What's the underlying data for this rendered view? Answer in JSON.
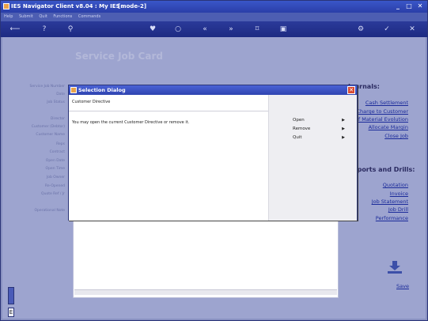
{
  "window": {
    "title": "IES Navigator Client v8.04 : My IES :",
    "mode": "[mode-2]",
    "controls": [
      "_",
      "□",
      "✕"
    ]
  },
  "menubar": [
    "Help",
    "Submit",
    "Quit",
    "Functions",
    "Commands"
  ],
  "page": {
    "title": "Service Job Card",
    "field_labels": [
      "Service Job Number",
      "Date",
      "Job Status",
      "Director",
      "Customer (Debtor)",
      "Customer Name",
      "Reps",
      "Contract",
      "Open Date",
      "Open Time",
      "Job Owner",
      "Re-Opened",
      "Quote Ref / Jr",
      "Operational Note"
    ]
  },
  "right_panel": {
    "journals_title": "Journals:",
    "journal_links": [
      "Cash Settlement",
      "Re-Charge to Customer",
      "Bill of Material Evolution",
      "Allocate Margin",
      "Close Job"
    ],
    "reports_title": "Reports and Drills:",
    "report_links": [
      "Quotation",
      "Invoice",
      "Job Statement",
      "Job Drill",
      "Performance"
    ],
    "save_label": "Save"
  },
  "dialog": {
    "title": "Selection Dialog",
    "heading": "Customer Directive",
    "message": "You may open the current Customer Directive or remove it.",
    "options": [
      {
        "label": "Open",
        "arrow": "▶"
      },
      {
        "label": "Remove",
        "arrow": "▶"
      },
      {
        "label": "Quit",
        "arrow": "▶"
      }
    ]
  }
}
